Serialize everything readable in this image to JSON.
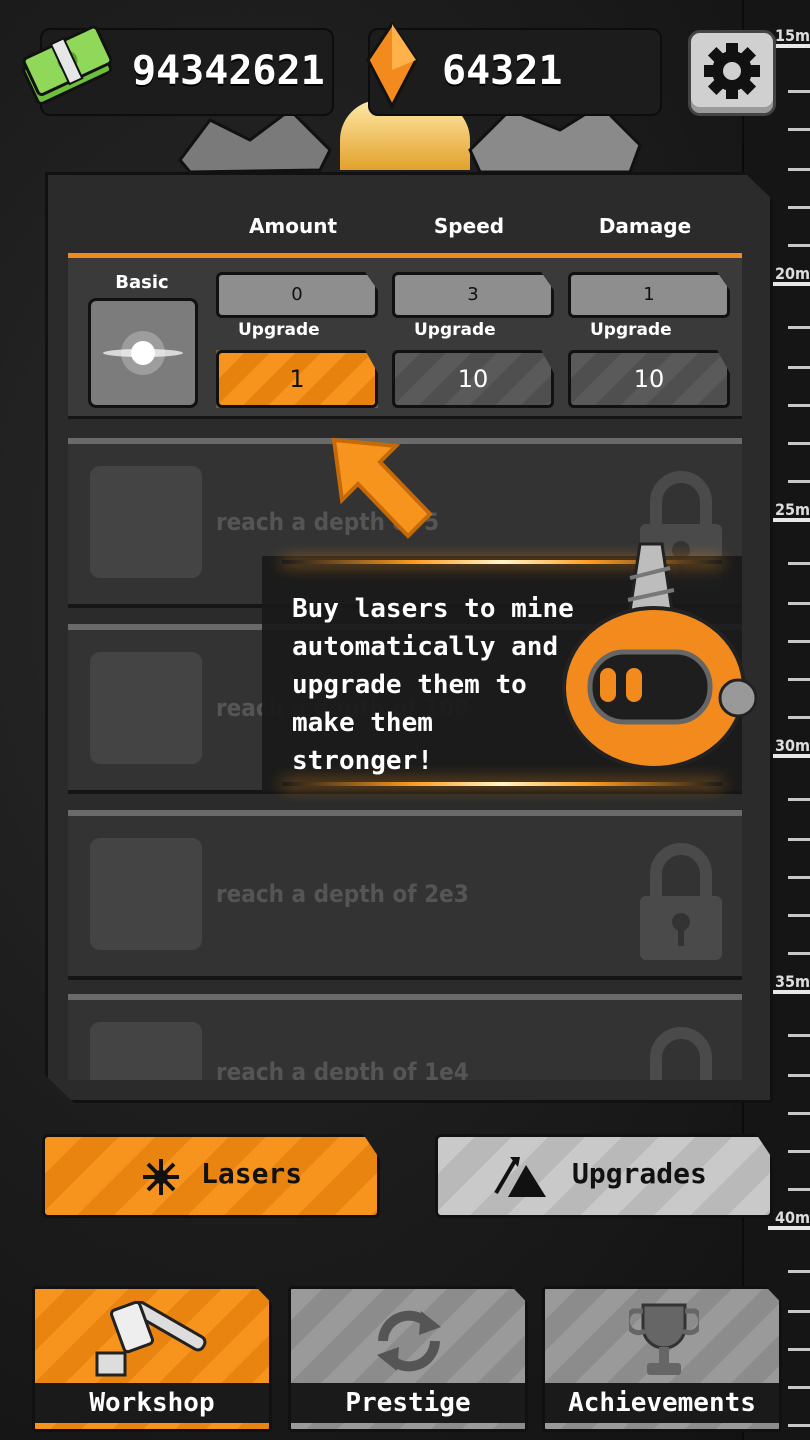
{
  "hud": {
    "cash": "94342621",
    "gems": "64321"
  },
  "depth_ruler": {
    "labels": [
      "15m",
      "20m",
      "25m",
      "30m",
      "35m",
      "40m"
    ]
  },
  "table": {
    "headers": [
      "Amount",
      "Speed",
      "Damage"
    ],
    "basic_row": {
      "name": "Basic",
      "stats": [
        "0",
        "3",
        "1"
      ],
      "upgrade_label": "Upgrade",
      "upgrade_costs": [
        "1",
        "10",
        "10"
      ]
    },
    "locked_rows": [
      {
        "text": "reach a depth of 5"
      },
      {
        "text": "reach a depth of 100"
      },
      {
        "text": "reach a depth of 2e3"
      },
      {
        "text": "reach a depth of 1e4"
      }
    ]
  },
  "tutorial": {
    "text": "Buy lasers to mine automatically and upgrade them to make them stronger!"
  },
  "tabs": {
    "lasers": "Lasers",
    "upgrades": "Upgrades"
  },
  "nav": {
    "workshop": "Workshop",
    "prestige": "Prestige",
    "achievements": "Achievements"
  },
  "colors": {
    "accent": "#f7941d",
    "panel": "#2b2b2b",
    "muted": "#8e8e8e"
  }
}
